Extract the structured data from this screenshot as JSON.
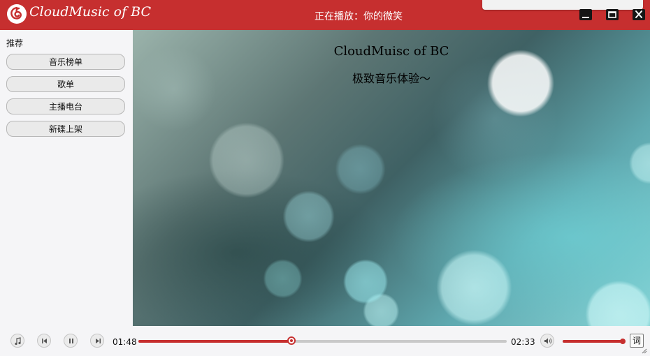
{
  "titlebar": {
    "app_title": "CloudMusic of BC",
    "now_playing": "正在播放：你的微笑",
    "icons": {
      "logo": "netease-music-logo-icon",
      "minimize": "minimize-icon",
      "maximize": "maximize-icon",
      "close": "close-icon"
    }
  },
  "sidebar": {
    "section_title": "推荐",
    "items": [
      {
        "label": "音乐榜单"
      },
      {
        "label": "歌单"
      },
      {
        "label": "主播电台"
      },
      {
        "label": "新碟上架"
      }
    ]
  },
  "main": {
    "title": "CloudMuisc of BC",
    "subtitle": "极致音乐体验～"
  },
  "player": {
    "current_time": "01:48",
    "total_time": "02:33",
    "progress_percent": 41.5,
    "volume_percent": 100,
    "lyrics_label": "词",
    "accent_color": "#c62f2f",
    "icons": {
      "music": "music-note-icon",
      "prev": "previous-icon",
      "pause": "pause-icon",
      "next": "next-icon",
      "volume": "volume-icon",
      "resize": "resize-grip-icon"
    }
  }
}
